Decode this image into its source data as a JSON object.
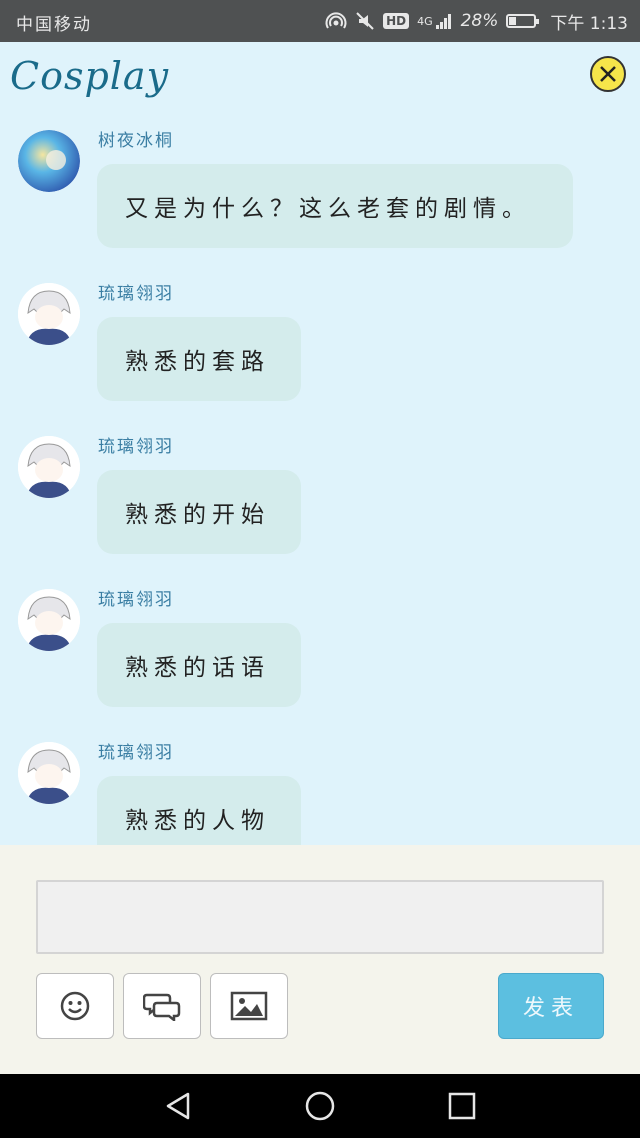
{
  "status_bar": {
    "carrier": "中国移动",
    "network": "4G",
    "hd": "HD",
    "battery_percent_text": "28%",
    "battery_level": 0.28,
    "time": "下午 1:13"
  },
  "header": {
    "title": "Cosplay",
    "close_icon": "close-x-icon",
    "accent": "#f6e54a"
  },
  "messages": [
    {
      "sender": "树夜冰桐",
      "text": "又是为什么？这么老套的剧情。",
      "avatar": "blue-watercolor-avatar"
    },
    {
      "sender": "琉璃翎羽",
      "text": "熟悉的套路",
      "avatar": "white-hair-anime-avatar"
    },
    {
      "sender": "琉璃翎羽",
      "text": "熟悉的开始",
      "avatar": "white-hair-anime-avatar"
    },
    {
      "sender": "琉璃翎羽",
      "text": "熟悉的话语",
      "avatar": "white-hair-anime-avatar"
    },
    {
      "sender": "琉璃翎羽",
      "text": "熟悉的人物",
      "avatar": "white-hair-anime-avatar"
    }
  ],
  "composer": {
    "input_value": "",
    "input_placeholder": "",
    "tools": [
      "smiley-icon",
      "chat-bubbles-icon",
      "image-icon"
    ],
    "send_label": "发表",
    "send_color": "#5cbfe0"
  },
  "nav": {
    "buttons": [
      "back-triangle-icon",
      "home-circle-icon",
      "recents-square-icon"
    ]
  }
}
